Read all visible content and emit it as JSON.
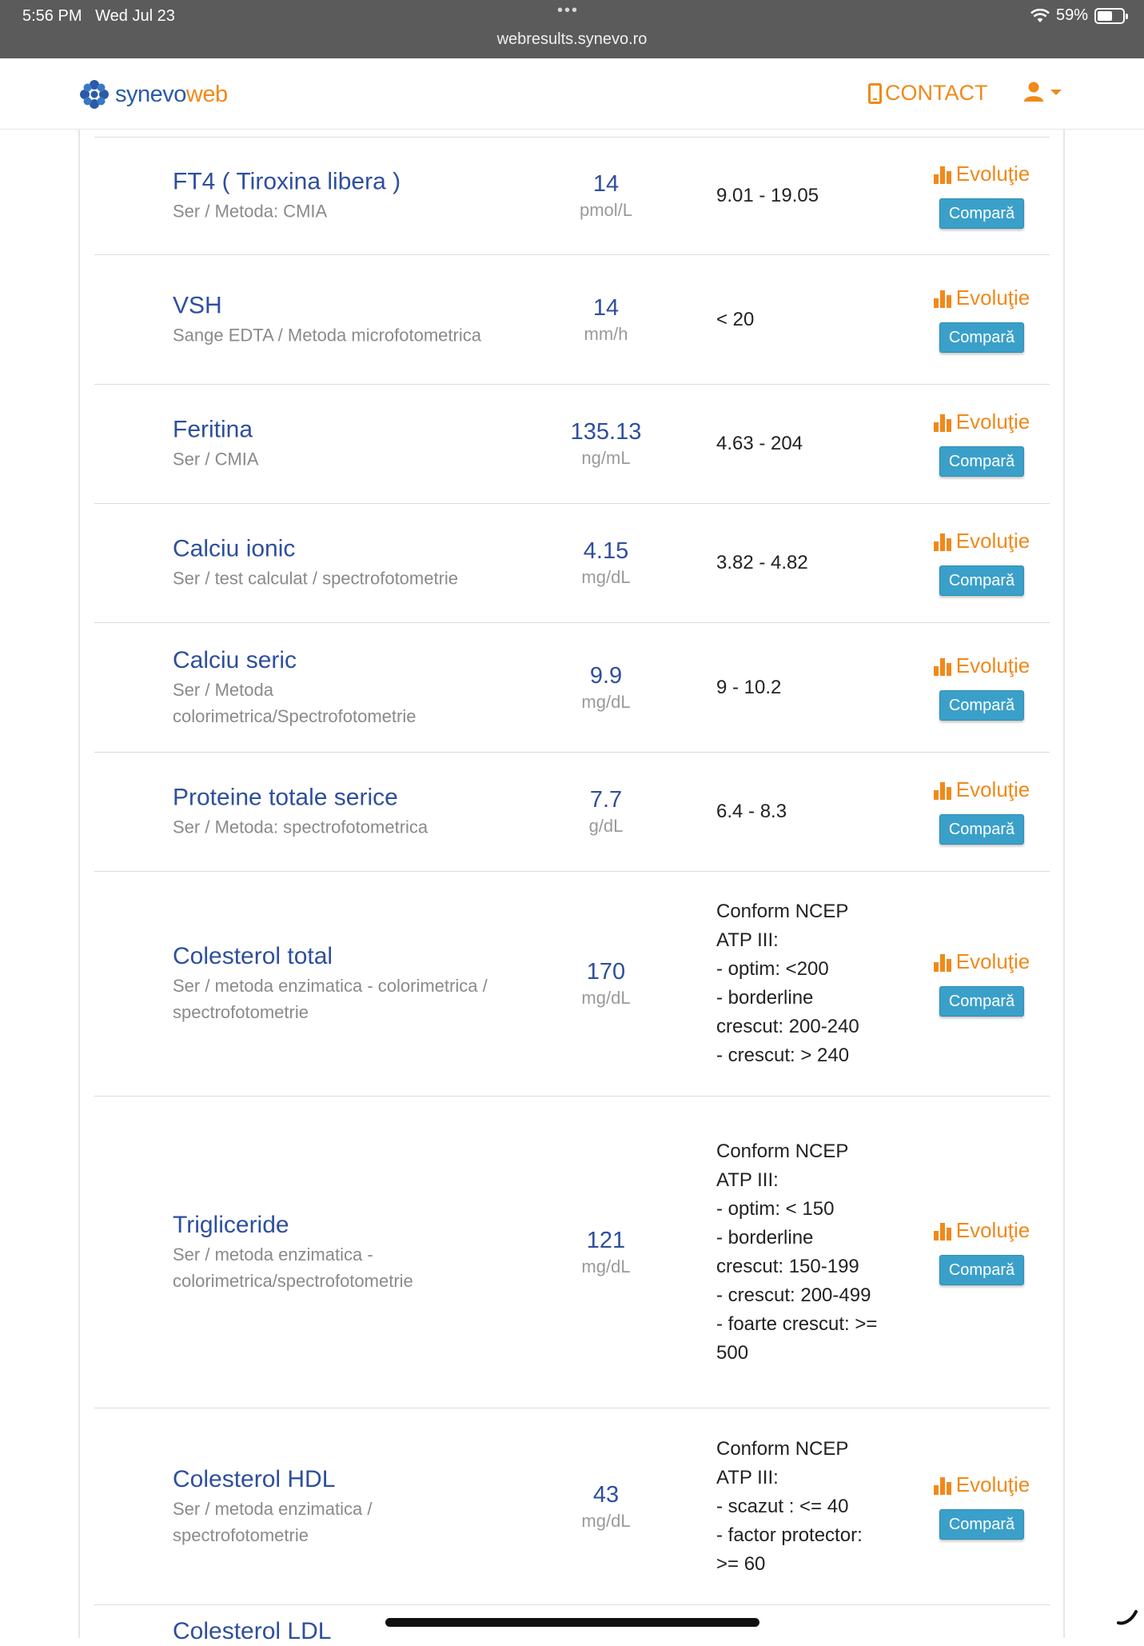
{
  "status_bar": {
    "time": "5:56 PM",
    "date": "Wed Jul 23",
    "url": "webresults.synevo.ro",
    "battery_text": "59%",
    "battery_level": 0.59
  },
  "header": {
    "logo_primary": "synevo",
    "logo_secondary": "web",
    "contact_label": "CONTACT"
  },
  "colors": {
    "accent_orange": "#f0891a",
    "link_blue": "#2e4f9e",
    "button_blue": "#3aa0c9",
    "status_bar_gray": "#5b5b5b"
  },
  "actions": {
    "evolution_label": "Evoluţie",
    "compare_label": "Compară"
  },
  "tests": [
    {
      "name": "FT4 ( Tiroxina libera )",
      "method": "Ser / Metoda: CMIA",
      "value": "14",
      "unit": "pmol/L",
      "reference": "9.01 - 19.05"
    },
    {
      "name": "VSH",
      "method": "Sange EDTA / Metoda microfotometrica",
      "value": "14",
      "unit": "mm/h",
      "reference": "< 20"
    },
    {
      "name": "Feritina",
      "method": "Ser / CMIA",
      "value": "135.13",
      "unit": "ng/mL",
      "reference": "4.63 - 204"
    },
    {
      "name": "Calciu ionic",
      "method": "Ser / test calculat / spectrofotometrie",
      "value": "4.15",
      "unit": "mg/dL",
      "reference": "3.82 - 4.82"
    },
    {
      "name": "Calciu seric",
      "method": "Ser / Metoda colorimetrica/Spectrofotometrie",
      "value": "9.9",
      "unit": "mg/dL",
      "reference": "9 - 10.2"
    },
    {
      "name": "Proteine totale serice",
      "method": "Ser / Metoda: spectrofotometrica",
      "value": "7.7",
      "unit": "g/dL",
      "reference": "6.4 - 8.3"
    },
    {
      "name": "Colesterol total",
      "method": "Ser / metoda enzimatica - colorimetrica / spectrofotometrie",
      "value": "170",
      "unit": "mg/dL",
      "reference": "Conform NCEP ATP III:\n- optim: <200\n- borderline crescut: 200-240\n- crescut: > 240"
    },
    {
      "name": "Trigliceride",
      "method": "Ser / metoda enzimatica - colorimetrica/spectrofotometrie",
      "value": "121",
      "unit": "mg/dL",
      "reference": "Conform NCEP ATP III:\n- optim: < 150\n- borderline crescut: 150-199\n- crescut: 200-499\n- foarte crescut: >= 500"
    },
    {
      "name": "Colesterol HDL",
      "method": "Ser / metoda enzimatica / spectrofotometrie",
      "value": "43",
      "unit": "mg/dL",
      "reference": "Conform NCEP ATP III:\n- scazut : <= 40\n- factor protector: >= 60"
    }
  ],
  "next_row_partial_name": "Colesterol LDL"
}
